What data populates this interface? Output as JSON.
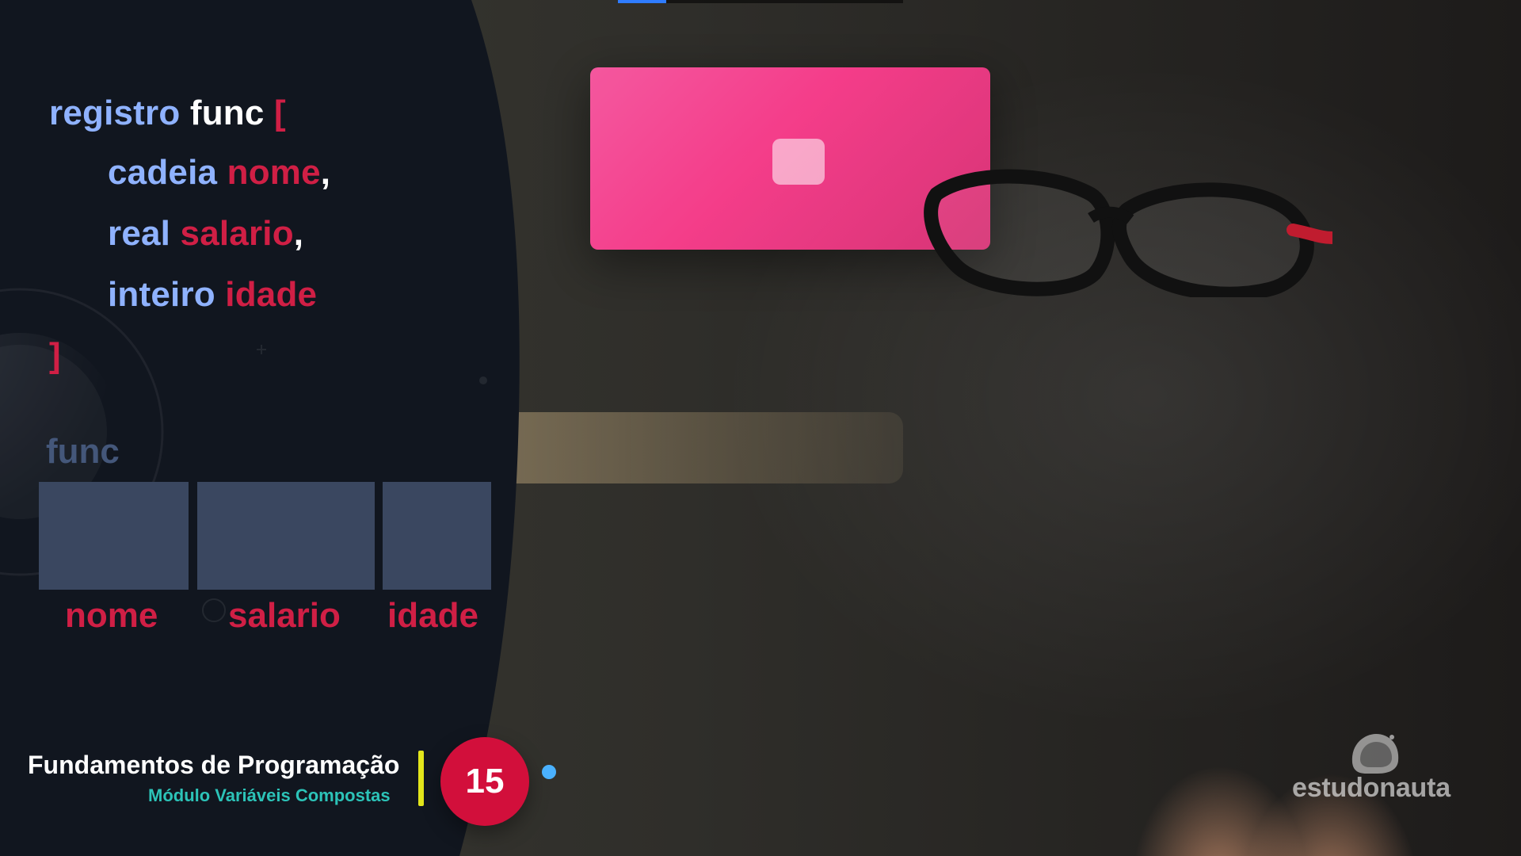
{
  "code": {
    "line1": {
      "kw": "registro",
      "id": "func",
      "bracket": "["
    },
    "line2": {
      "kw": "cadeia",
      "var": "nome",
      "punc": ","
    },
    "line3": {
      "kw": "real",
      "var": "salario",
      "punc": ","
    },
    "line4": {
      "kw": "inteiro",
      "var": "idade"
    },
    "line5": {
      "bracket": "]"
    }
  },
  "structure": {
    "title": "func",
    "fields": [
      "nome",
      "salario",
      "idade"
    ]
  },
  "lower_third": {
    "title": "Fundamentos de Programação",
    "subtitle": "Módulo Variáveis Compostas",
    "number": "15"
  },
  "brand": {
    "name": "estudonauta"
  },
  "icons": {
    "brand_icon": "astronaut-helmet-icon"
  },
  "colors": {
    "panel_bg": "#11161f",
    "keyword_blue": "#8fb2ff",
    "accent_red": "#d01f45",
    "box_gray": "#3a4760",
    "subtitle_teal": "#2cc3b8",
    "divider_yellow": "#e3e61b",
    "dot_blue": "#4ab1ff"
  },
  "progress": {
    "top_bar_fraction": 0.17
  }
}
